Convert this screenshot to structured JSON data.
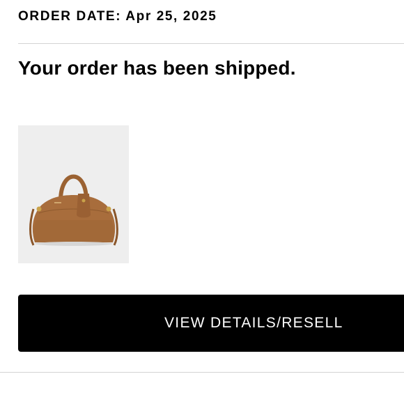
{
  "order": {
    "date_label": "ORDER DATE: Apr 25, 2025",
    "headline": "Your order has been shipped."
  },
  "product": {
    "image_icon": "handbag-image",
    "image_bg": "#eeeeee",
    "bag_color": "#a86d3c"
  },
  "actions": {
    "view_details_label": "VIEW DETAILS/RESELL"
  },
  "colors": {
    "button_bg": "#000000",
    "button_text": "#ffffff",
    "divider": "#d4d4d4"
  }
}
